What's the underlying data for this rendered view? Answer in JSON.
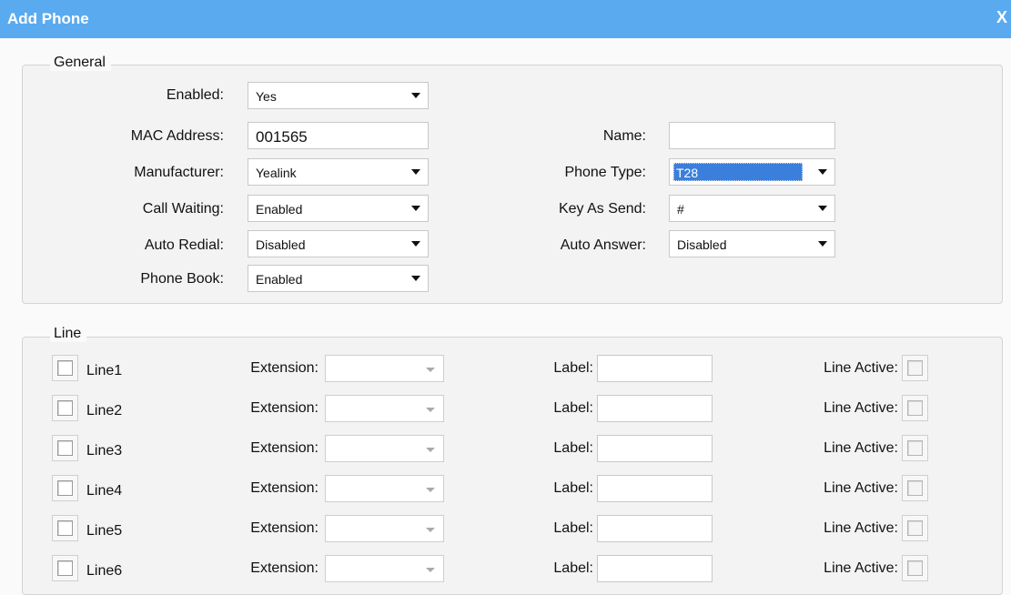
{
  "dialog": {
    "title": "Add Phone",
    "close": "X"
  },
  "general": {
    "legend": "General",
    "enabled": {
      "label": "Enabled:",
      "value": "Yes"
    },
    "mac": {
      "label": "MAC Address:",
      "value": "001565"
    },
    "name": {
      "label": "Name:",
      "value": ""
    },
    "manufacturer": {
      "label": "Manufacturer:",
      "value": "Yealink"
    },
    "phone_type": {
      "label": "Phone Type:",
      "value": "T28"
    },
    "call_waiting": {
      "label": "Call Waiting:",
      "value": "Enabled"
    },
    "key_as_send": {
      "label": "Key As Send:",
      "value": "#"
    },
    "auto_redial": {
      "label": "Auto Redial:",
      "value": "Disabled"
    },
    "auto_answer": {
      "label": "Auto Answer:",
      "value": "Disabled"
    },
    "phone_book": {
      "label": "Phone Book:",
      "value": "Enabled"
    }
  },
  "line": {
    "legend": "Line",
    "extension_label": "Extension:",
    "label_label": "Label:",
    "active_label": "Line Active:",
    "rows": [
      {
        "name": "Line1",
        "checked": false,
        "extension": "",
        "label": "",
        "active": false
      },
      {
        "name": "Line2",
        "checked": false,
        "extension": "",
        "label": "",
        "active": false
      },
      {
        "name": "Line3",
        "checked": false,
        "extension": "",
        "label": "",
        "active": false
      },
      {
        "name": "Line4",
        "checked": false,
        "extension": "",
        "label": "",
        "active": false
      },
      {
        "name": "Line5",
        "checked": false,
        "extension": "",
        "label": "",
        "active": false
      },
      {
        "name": "Line6",
        "checked": false,
        "extension": "",
        "label": "",
        "active": false
      }
    ]
  },
  "colors": {
    "titlebar": "#5aaaf0",
    "selection": "#3b7fdc"
  }
}
